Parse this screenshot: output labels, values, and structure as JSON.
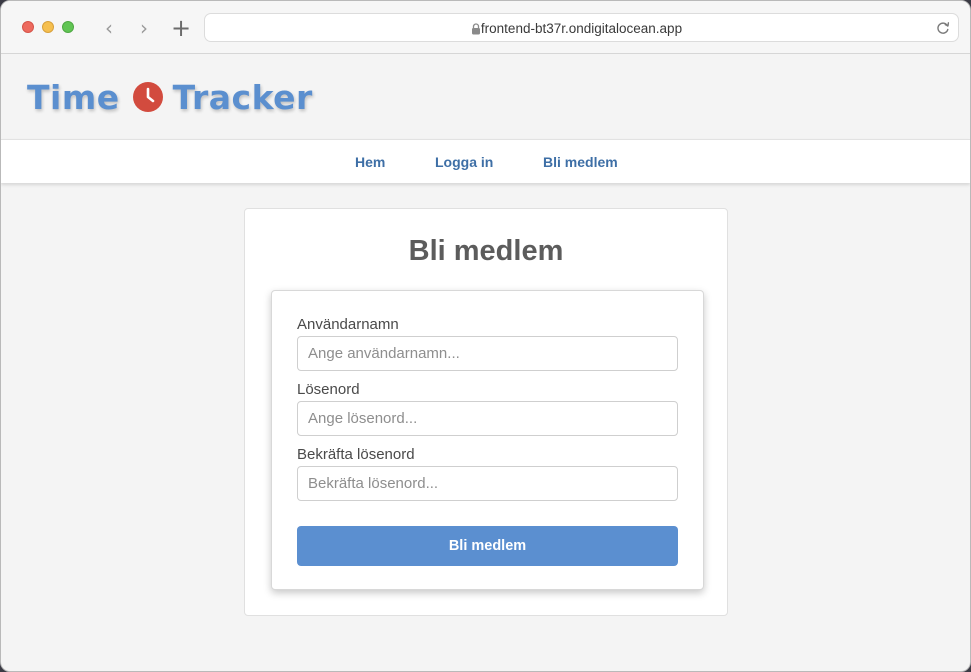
{
  "browser": {
    "url": "frontend-bt37r.ondigitalocean.app",
    "back_glyph": "‹",
    "forward_glyph": "›",
    "new_tab_glyph": "+"
  },
  "logo": {
    "word1": "Time",
    "word2": "Tracker",
    "color": "#5b8fcf",
    "icon": "clock-icon",
    "icon_color": "#d24b3e"
  },
  "nav": {
    "items": [
      {
        "label": "Hem"
      },
      {
        "label": "Logga in"
      },
      {
        "label": "Bli medlem"
      }
    ]
  },
  "signup": {
    "title": "Bli medlem",
    "username_label": "Användarnamn",
    "username_placeholder": "Ange användarnamn...",
    "password_label": "Lösenord",
    "password_placeholder": "Ange lösenord...",
    "confirm_label": "Bekräfta lösenord",
    "confirm_placeholder": "Bekräfta lösenord...",
    "submit_label": "Bli medlem",
    "accent_color": "#5b8fd0"
  }
}
